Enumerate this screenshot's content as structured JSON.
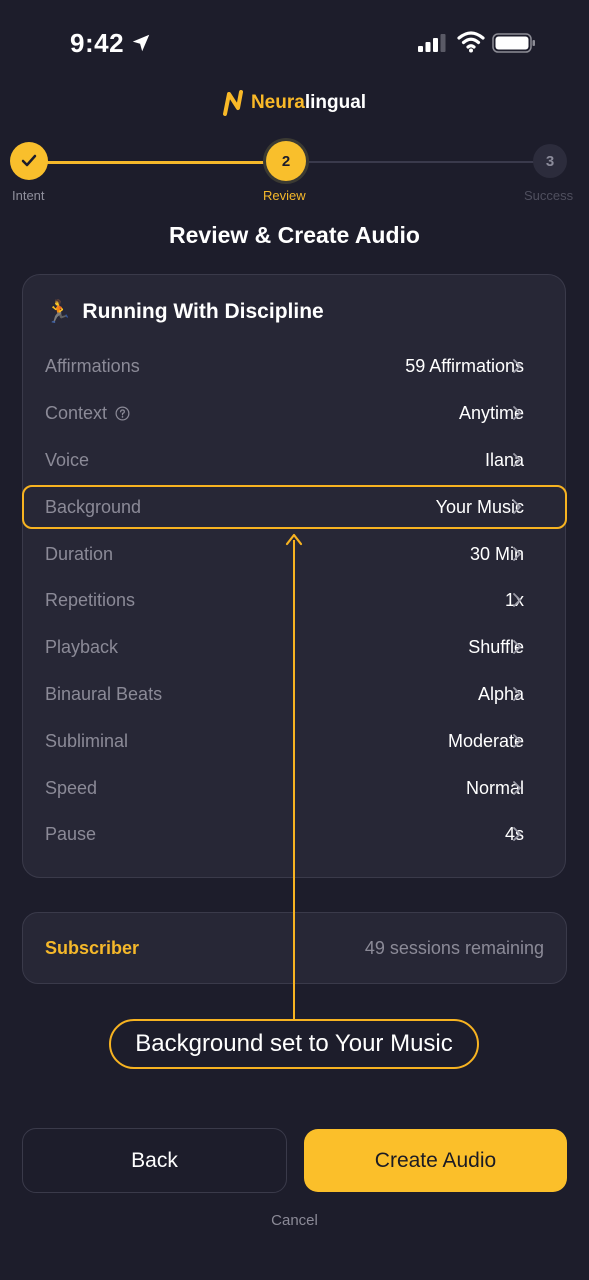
{
  "status_bar": {
    "time": "9:42",
    "icons": [
      "location-arrow-icon",
      "signal-icon",
      "wifi-icon",
      "battery-icon"
    ]
  },
  "logo": {
    "text_accent": "Neura",
    "text_main": "lingual",
    "color": "#f9b928"
  },
  "stepper": {
    "steps": [
      {
        "label": "Intent",
        "state": "done"
      },
      {
        "label": "Review",
        "number": "2",
        "state": "active"
      },
      {
        "label": "Success",
        "number": "3",
        "state": "pending"
      }
    ]
  },
  "page_title": "Review & Create Audio",
  "card": {
    "title": "Running With Discipline",
    "rows": [
      {
        "label": "Affirmations",
        "value": "59 Affirmations"
      },
      {
        "label": "Context",
        "value": "Anytime"
      },
      {
        "label": "Voice",
        "value": "Ilana"
      },
      {
        "label": "Background",
        "value": "Your Music"
      },
      {
        "label": "Duration",
        "value": "30 Min"
      },
      {
        "label": "Repetitions",
        "value": "1x"
      },
      {
        "label": "Playback",
        "value": "Shuffle"
      },
      {
        "label": "Binaural Beats",
        "value": "Alpha"
      },
      {
        "label": "Subliminal",
        "value": "Moderate"
      },
      {
        "label": "Speed",
        "value": "Normal"
      },
      {
        "label": "Pause",
        "value": "4s"
      }
    ]
  },
  "annotation": {
    "text": "Background set to Your Music",
    "color": "#f7b321"
  },
  "subscription": {
    "label": "Subscriber",
    "value": "49 sessions remaining"
  },
  "buttons": {
    "back": "Back",
    "create": "Create Audio",
    "cancel": "Cancel"
  },
  "colors": {
    "background": "#1d1d2b",
    "accent": "#fbbf2a",
    "card": "#272736"
  }
}
